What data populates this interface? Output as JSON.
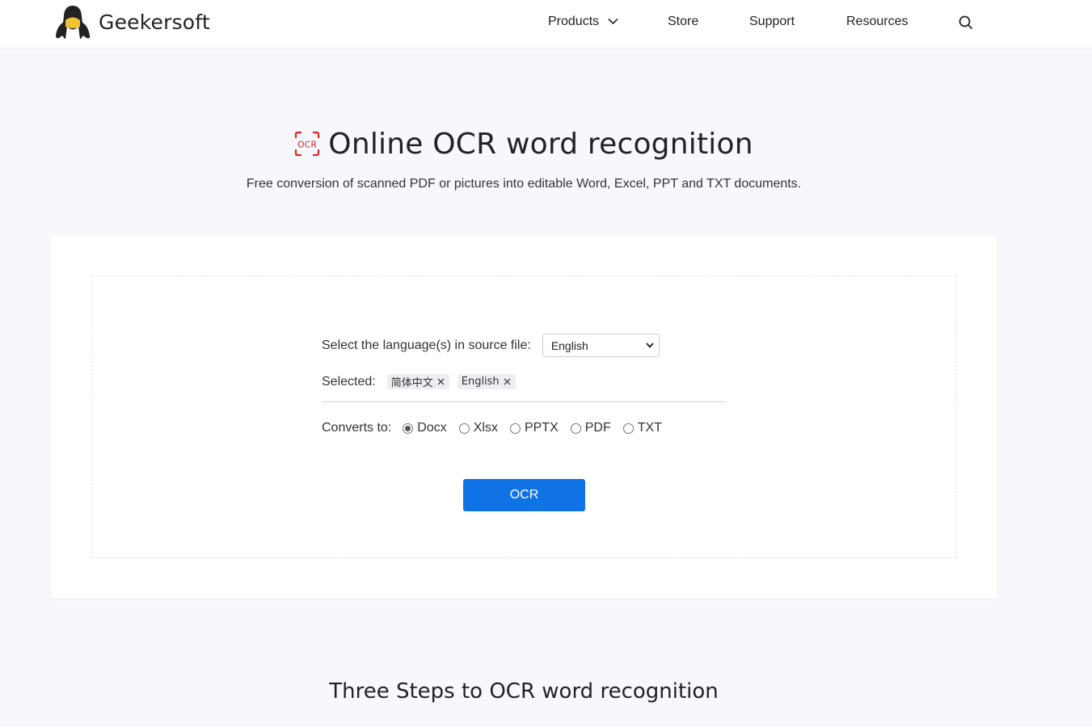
{
  "header": {
    "brand": "Geekersoft",
    "nav": {
      "products": "Products",
      "store": "Store",
      "support": "Support",
      "resources": "Resources"
    }
  },
  "hero": {
    "title": "Online OCR word recognition",
    "icon_text": "OCR",
    "subtitle": "Free conversion of scanned PDF or pictures into editable Word, Excel, PPT and TXT documents."
  },
  "tool": {
    "language_label": "Select the language(s) in source file:",
    "language_value": "English",
    "selected_label": "Selected:",
    "selected_tags": [
      "简体中文",
      "English"
    ],
    "converts_label": "Converts to:",
    "formats": [
      "Docx",
      "Xlsx",
      "PPTX",
      "PDF",
      "TXT"
    ],
    "selected_format": "Docx",
    "ocr_button": "OCR"
  },
  "steps": {
    "title": "Three Steps to OCR word recognition"
  },
  "colors": {
    "accent": "#0f72e5",
    "icon_red": "#e0262b",
    "page_bg": "#f6f8fb"
  }
}
